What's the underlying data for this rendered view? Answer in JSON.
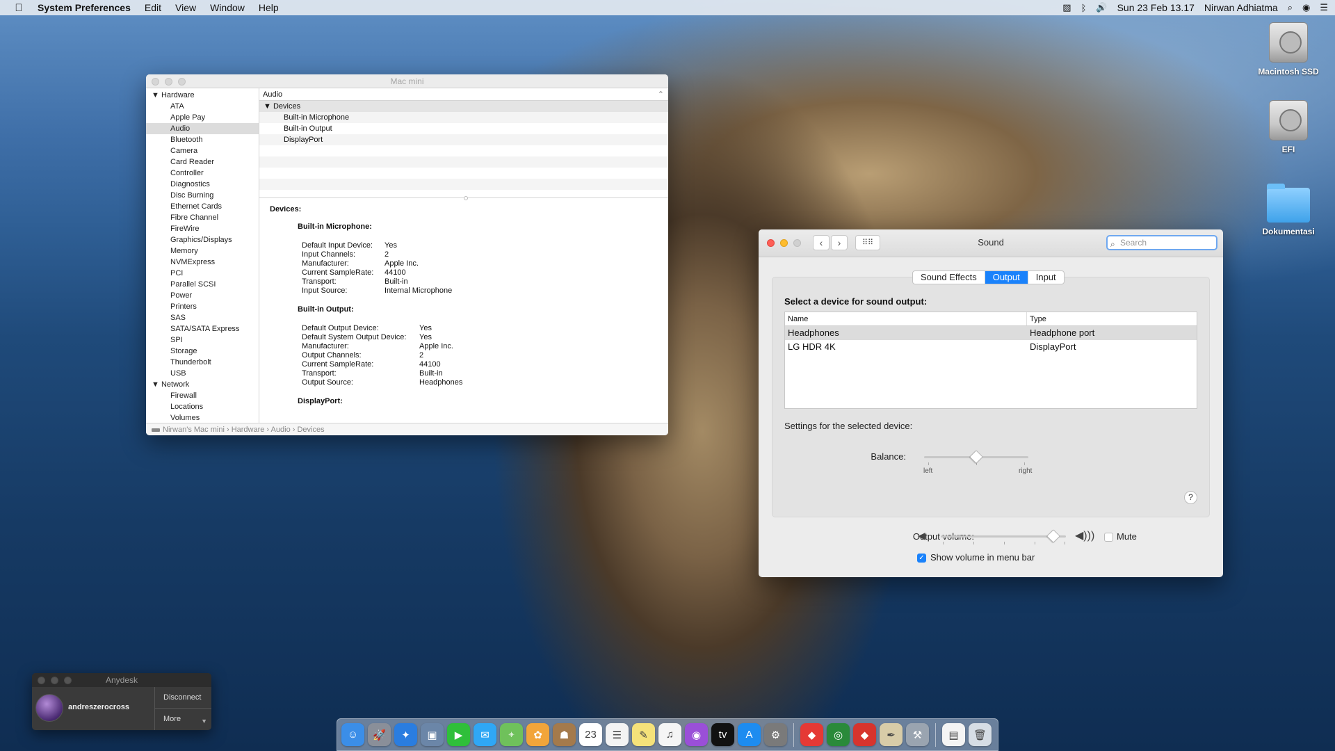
{
  "menubar": {
    "apple": "",
    "items": [
      "System Preferences",
      "Edit",
      "View",
      "Window",
      "Help"
    ],
    "datetime": "Sun 23 Feb 13.17",
    "user": "Nirwan Adhiatma"
  },
  "desktop": {
    "icons": [
      "Macintosh SSD",
      "EFI",
      "Dokumentasi"
    ]
  },
  "sysinfo": {
    "title": "Mac mini",
    "sidebar": {
      "hardware_label": "Hardware",
      "hardware_items": [
        "ATA",
        "Apple Pay",
        "Audio",
        "Bluetooth",
        "Camera",
        "Card Reader",
        "Controller",
        "Diagnostics",
        "Disc Burning",
        "Ethernet Cards",
        "Fibre Channel",
        "FireWire",
        "Graphics/Displays",
        "Memory",
        "NVMExpress",
        "PCI",
        "Parallel SCSI",
        "Power",
        "Printers",
        "SAS",
        "SATA/SATA Express",
        "SPI",
        "Storage",
        "Thunderbolt",
        "USB"
      ],
      "network_label": "Network",
      "network_items": [
        "Firewall",
        "Locations",
        "Volumes"
      ],
      "selected": "Audio"
    },
    "header": "Audio",
    "tree": {
      "group": "Devices",
      "rows": [
        "Built-in Microphone",
        "Built-in Output",
        "DisplayPort"
      ]
    },
    "detail": {
      "devices_label": "Devices:",
      "mic_label": "Built-in Microphone:",
      "mic": [
        [
          "Default Input Device:",
          "Yes"
        ],
        [
          "Input Channels:",
          "2"
        ],
        [
          "Manufacturer:",
          "Apple Inc."
        ],
        [
          "Current SampleRate:",
          "44100"
        ],
        [
          "Transport:",
          "Built-in"
        ],
        [
          "Input Source:",
          "Internal Microphone"
        ]
      ],
      "out_label": "Built-in Output:",
      "out": [
        [
          "Default Output Device:",
          "Yes"
        ],
        [
          "Default System Output Device:",
          "Yes"
        ],
        [
          "Manufacturer:",
          "Apple Inc."
        ],
        [
          "Output Channels:",
          "2"
        ],
        [
          "Current SampleRate:",
          "44100"
        ],
        [
          "Transport:",
          "Built-in"
        ],
        [
          "Output Source:",
          "Headphones"
        ]
      ],
      "dp_label": "DisplayPort:"
    },
    "path": [
      "Nirwan's Mac mini",
      "Hardware",
      "Audio",
      "Devices"
    ]
  },
  "sound": {
    "title": "Sound",
    "search_placeholder": "Search",
    "tabs": [
      "Sound Effects",
      "Output",
      "Input"
    ],
    "active_tab": "Output",
    "select_label": "Select a device for sound output:",
    "columns": [
      "Name",
      "Type"
    ],
    "devices": [
      {
        "name": "Headphones",
        "type": "Headphone port",
        "selected": true
      },
      {
        "name": "LG HDR 4K",
        "type": "DisplayPort",
        "selected": false
      }
    ],
    "settings_label": "Settings for the selected device:",
    "balance_label": "Balance:",
    "balance_left": "left",
    "balance_right": "right",
    "balance_value": 0.5,
    "help": "?",
    "volume_label": "Output volume:",
    "volume_value": 0.9,
    "mute_label": "Mute",
    "mute_checked": false,
    "show_volume_label": "Show volume in menu bar",
    "show_volume_checked": true
  },
  "anydesk": {
    "title": "Anydesk",
    "user": "andreszerocross",
    "disconnect": "Disconnect",
    "more": "More"
  },
  "dock": {
    "apps": [
      {
        "name": "finder-icon",
        "color": "#3b8ee8",
        "glyph": "☺"
      },
      {
        "name": "launchpad-icon",
        "color": "#8a8f99",
        "glyph": "🚀"
      },
      {
        "name": "safari-icon",
        "color": "#2a7de0",
        "glyph": "✦"
      },
      {
        "name": "preview-icon",
        "color": "#6b86a8",
        "glyph": "▣"
      },
      {
        "name": "facetime-icon",
        "color": "#2fbf3a",
        "glyph": "▶"
      },
      {
        "name": "messages-icon",
        "color": "#2fa7f5",
        "glyph": "✉"
      },
      {
        "name": "maps-icon",
        "color": "#6fc15b",
        "glyph": "⌖"
      },
      {
        "name": "photos-icon",
        "color": "#f2a53a",
        "glyph": "✿"
      },
      {
        "name": "contacts-icon",
        "color": "#a47a4c",
        "glyph": "☗"
      },
      {
        "name": "calendar-icon",
        "color": "#ffffff",
        "glyph": "23"
      },
      {
        "name": "reminders-icon",
        "color": "#f3f3f3",
        "glyph": "☰"
      },
      {
        "name": "notes-icon",
        "color": "#f5e27a",
        "glyph": "✎"
      },
      {
        "name": "music-icon",
        "color": "#f5f5f5",
        "glyph": "♫"
      },
      {
        "name": "podcasts-icon",
        "color": "#9a4fd8",
        "glyph": "◉"
      },
      {
        "name": "appletv-icon",
        "color": "#111111",
        "glyph": "tv"
      },
      {
        "name": "appstore-icon",
        "color": "#1d8cf0",
        "glyph": "A"
      },
      {
        "name": "system-preferences-icon",
        "color": "#7a7a7a",
        "glyph": "⚙"
      },
      {
        "name": "anydesk-icon",
        "color": "#e53935",
        "glyph": "◆"
      },
      {
        "name": "activity-monitor-icon",
        "color": "#2a8a3a",
        "glyph": "◎"
      },
      {
        "name": "anydesk-icon-2",
        "color": "#d7342d",
        "glyph": "◆"
      },
      {
        "name": "script-editor-icon",
        "color": "#d8cca8",
        "glyph": "✒"
      },
      {
        "name": "automator-icon",
        "color": "#9aa4b0",
        "glyph": "⚒"
      },
      {
        "name": "documents-stack-icon",
        "color": "#f4f4f4",
        "glyph": "▤"
      },
      {
        "name": "trash-icon",
        "color": "#d6dde5",
        "glyph": "🗑"
      }
    ]
  }
}
